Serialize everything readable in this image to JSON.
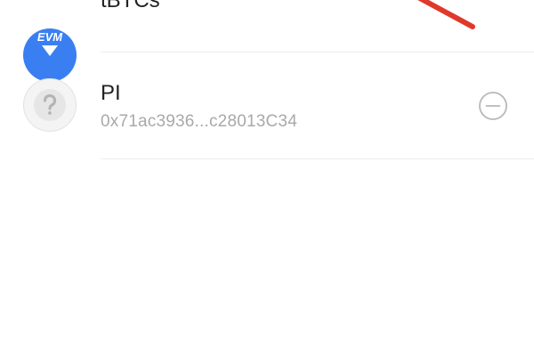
{
  "tokens": [
    {
      "name": "tBTCs",
      "icon": "evm-icon",
      "icon_text": "EVM",
      "icon_color": "#3a7ff2"
    },
    {
      "name": "PI",
      "address": "0x71ac3936...c28013C34",
      "icon": "unknown-token-icon",
      "action": "remove-circle-icon"
    }
  ],
  "colors": {
    "text_primary": "#222222",
    "text_secondary": "#a9a9a9",
    "divider": "#ececec",
    "annotation_arrow": "#e0392b"
  }
}
